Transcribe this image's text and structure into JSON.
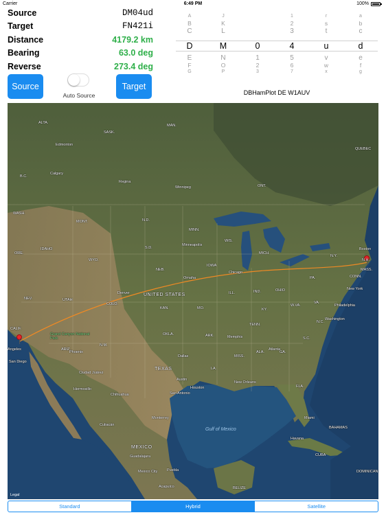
{
  "status_bar": {
    "carrier": "Carrier",
    "time": "6:49 PM",
    "battery": "100%"
  },
  "info": {
    "source": {
      "label": "Source",
      "value": "DM04ud"
    },
    "target": {
      "label": "Target",
      "value": "FN421i"
    },
    "distance": {
      "label": "Distance",
      "value": "4179.2 km"
    },
    "bearing": {
      "label": "Bearing",
      "value": "63.0 deg"
    },
    "reverse": {
      "label": "Reverse",
      "value": "273.4 deg"
    }
  },
  "buttons": {
    "source": "Source",
    "target": "Target"
  },
  "auto_source": {
    "label": "Auto Source",
    "enabled": false
  },
  "picker": {
    "columns": [
      {
        "items": [
          "A",
          "B",
          "C",
          "D",
          "E",
          "F",
          "G"
        ],
        "selected": "D"
      },
      {
        "items": [
          "J",
          "K",
          "L",
          "M",
          "N",
          "O",
          "P"
        ],
        "selected": "M"
      },
      {
        "items": [
          "",
          "",
          "",
          "0",
          "1",
          "2",
          "3"
        ],
        "selected": "0"
      },
      {
        "items": [
          "1",
          "2",
          "3",
          "4",
          "5",
          "6",
          "7"
        ],
        "selected": "4"
      },
      {
        "items": [
          "r",
          "s",
          "t",
          "u",
          "v",
          "w",
          "x"
        ],
        "selected": "u"
      },
      {
        "items": [
          "a",
          "b",
          "c",
          "d",
          "e",
          "f",
          "g"
        ],
        "selected": "d"
      }
    ],
    "caption": "DBHamPlot DE W1AUV"
  },
  "map": {
    "mode": "Hybrid",
    "labels": {
      "alberta": "ALTA.",
      "sask": "SASK.",
      "manitoba": "MAN.",
      "ontario": "ONT.",
      "quebec": "QUEBEC",
      "edmonton": "Edmonton",
      "calgary": "Calgary",
      "regina": "Regina",
      "winnipeg": "Winnipeg",
      "bc": "B.C.",
      "wa": "WASH.",
      "mont": "MONT.",
      "nd": "N.D.",
      "sd": "S.D.",
      "minn": "MINN.",
      "idaho": "IDAHO",
      "ore": "ORE.",
      "wyo": "WYO.",
      "neb": "NEB.",
      "iowa": "IOWA",
      "wis": "WIS.",
      "mich": "MICH.",
      "minneapolis": "Minneapolis",
      "omaha": "Omaha",
      "chicago": "Chicago",
      "denver": "Denver",
      "utah": "UTAH",
      "nev": "NEV.",
      "colo": "COLO.",
      "kan": "KAN.",
      "mo": "MO.",
      "ill": "ILL.",
      "ind": "IND.",
      "ohio": "OHIO",
      "pa": "PA.",
      "ny": "N.Y.",
      "united_states": "UNITED STATES",
      "calif": "CALIF.",
      "ariz": "ARIZ.",
      "nm": "N.M.",
      "okla": "OKLA.",
      "ark": "ARK.",
      "tenn": "TENN.",
      "ky": "KY.",
      "va": "VA.",
      "wva": "W.VA.",
      "nc": "N.C.",
      "sc": "S.C.",
      "ga": "GA.",
      "ala": "ALA.",
      "miss": "MISS.",
      "la": "LA.",
      "texas": "TEXAS",
      "fla": "FLA.",
      "phoenix": "Phoenix",
      "san_diego": "San Diego",
      "los_angeles": "Angeles",
      "dallas": "Dallas",
      "houston": "Houston",
      "san_antonio": "San Antonio",
      "austin": "Austin",
      "memphis": "Memphis",
      "atlanta": "Atlanta",
      "new_york": "New York",
      "philadelphia": "Philadelphia",
      "washington": "Washington",
      "boston": "Boston",
      "new_orleans": "New Orleans",
      "miami": "Miami",
      "havana": "Havana",
      "cuba": "CUBA",
      "bahamas": "BAHAMAS",
      "gulf": "Gulf of Mexico",
      "mexico": "MEXICO",
      "mexico_city": "Mexico City",
      "monterrey": "Monterrey",
      "hermosillo": "Hermosillo",
      "chihuahua": "Chihuahua",
      "culiacan": "Culiacán",
      "guadalajara": "Guadalajara",
      "puebla": "Puebla",
      "acapulco": "Acapulco",
      "belize": "BELIZE",
      "cuidad_juarez": "Ciudad Juárez",
      "conn": "CONN.",
      "mass": "MASS.",
      "nh": "N.H.",
      "grand_canyon": "Grand Canyon National Park",
      "dominican": "DOMINICAN",
      "legal": "Legal"
    }
  },
  "segments": [
    "Standard",
    "Hybrid",
    "Satellite"
  ],
  "colors": {
    "accent": "#1a8cf0",
    "value_green": "#2eaf49",
    "route": "#f08a24",
    "pin": "#e8252a"
  }
}
